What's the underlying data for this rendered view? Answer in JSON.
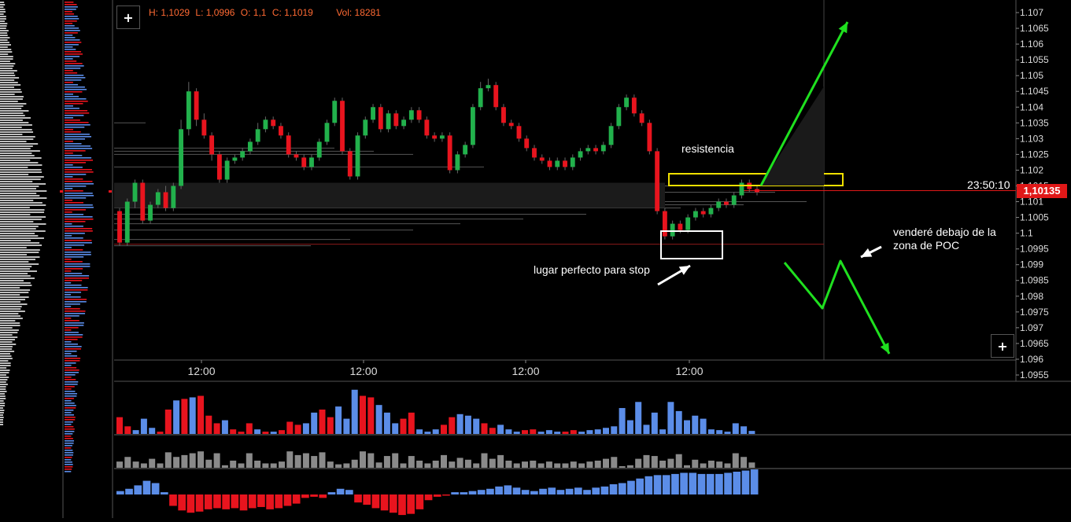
{
  "header": {
    "high": "H: 1,1029",
    "low": "L: 1,0996",
    "open": "O: 1,1",
    "close": "C: 1,1019",
    "volume": "Vol: 18281"
  },
  "buttons": {
    "add_top": "+",
    "add_bottom": "+"
  },
  "annotations": {
    "resistance": "resistencia",
    "stop": "lugar perfecto para stop",
    "sell_line1": "venderé debajo de la",
    "sell_line2": "zona de POC"
  },
  "timer": "23:50:10",
  "current_price": "1,10135",
  "colors": {
    "up": "#22b14c",
    "down": "#e8141e",
    "arrow": "#1fe01f",
    "zone": "#f0e000",
    "blue": "#5b8de8"
  },
  "chart_data": {
    "type": "candlestick",
    "x_ticks": [
      "12:00",
      "12:00",
      "12:00",
      "12:00"
    ],
    "y_ticks": [
      "1.107",
      "1.1065",
      "1.106",
      "1.1055",
      "1.105",
      "1.1045",
      "1.104",
      "1.1035",
      "1.103",
      "1.1025",
      "1.102",
      "1.1015",
      "1.101",
      "1.1005",
      "1.1",
      "1.0995",
      "1.099",
      "1.0985",
      "1.098",
      "1.0975",
      "1.097",
      "1.0965",
      "1.096",
      "1.0955"
    ],
    "ylim": [
      1.0955,
      1.107
    ],
    "candles": [
      [
        1.1007,
        1.0997,
        1.1008,
        1.0996
      ],
      [
        1.0997,
        1.101,
        1.1011,
        1.0996
      ],
      [
        1.101,
        1.1016,
        1.1017,
        1.1008
      ],
      [
        1.1016,
        1.1004,
        1.1017,
        1.1003
      ],
      [
        1.1004,
        1.1009,
        1.101,
        1.1003
      ],
      [
        1.1009,
        1.1013,
        1.1014,
        1.1008
      ],
      [
        1.1013,
        1.1008,
        1.1015,
        1.1007
      ],
      [
        1.1008,
        1.1015,
        1.1016,
        1.1007
      ],
      [
        1.1015,
        1.1033,
        1.1036,
        1.1014
      ],
      [
        1.1033,
        1.1045,
        1.1048,
        1.1031
      ],
      [
        1.1045,
        1.1036,
        1.1046,
        1.1034
      ],
      [
        1.1036,
        1.1031,
        1.1038,
        1.103
      ],
      [
        1.1031,
        1.1025,
        1.1032,
        1.1023
      ],
      [
        1.1025,
        1.1017,
        1.1026,
        1.1016
      ],
      [
        1.1017,
        1.1023,
        1.1024,
        1.1016
      ],
      [
        1.1023,
        1.1024,
        1.1025,
        1.1022
      ],
      [
        1.1024,
        1.1026,
        1.1027,
        1.1023
      ],
      [
        1.1026,
        1.1029,
        1.103,
        1.1025
      ],
      [
        1.1029,
        1.1033,
        1.1035,
        1.1028
      ],
      [
        1.1033,
        1.1036,
        1.1037,
        1.1032
      ],
      [
        1.1036,
        1.1034,
        1.1037,
        1.1033
      ],
      [
        1.1034,
        1.1031,
        1.1035,
        1.103
      ],
      [
        1.1031,
        1.1025,
        1.1032,
        1.1024
      ],
      [
        1.1025,
        1.1024,
        1.1026,
        1.1023
      ],
      [
        1.1024,
        1.1021,
        1.1025,
        1.102
      ],
      [
        1.1021,
        1.1024,
        1.1025,
        1.102
      ],
      [
        1.1024,
        1.1029,
        1.103,
        1.1023
      ],
      [
        1.1029,
        1.1035,
        1.1036,
        1.1028
      ],
      [
        1.1035,
        1.1042,
        1.1043,
        1.1034
      ],
      [
        1.1042,
        1.1026,
        1.1043,
        1.1025
      ],
      [
        1.1026,
        1.1018,
        1.1027,
        1.1017
      ],
      [
        1.1018,
        1.1031,
        1.1032,
        1.1017
      ],
      [
        1.1031,
        1.1036,
        1.1037,
        1.103
      ],
      [
        1.1036,
        1.104,
        1.1041,
        1.1035
      ],
      [
        1.104,
        1.1033,
        1.1041,
        1.1032
      ],
      [
        1.1033,
        1.1038,
        1.1039,
        1.1032
      ],
      [
        1.1038,
        1.1034,
        1.1039,
        1.1033
      ],
      [
        1.1034,
        1.1036,
        1.1037,
        1.1033
      ],
      [
        1.1036,
        1.1039,
        1.104,
        1.1035
      ],
      [
        1.1039,
        1.1036,
        1.104,
        1.1035
      ],
      [
        1.1036,
        1.1031,
        1.1037,
        1.103
      ],
      [
        1.1031,
        1.103,
        1.1032,
        1.1029
      ],
      [
        1.103,
        1.1031,
        1.1032,
        1.1029
      ],
      [
        1.1031,
        1.102,
        1.1032,
        1.1019
      ],
      [
        1.102,
        1.1025,
        1.1026,
        1.1019
      ],
      [
        1.1025,
        1.1028,
        1.1029,
        1.1024
      ],
      [
        1.1028,
        1.104,
        1.1041,
        1.1027
      ],
      [
        1.104,
        1.1046,
        1.1048,
        1.1039
      ],
      [
        1.1046,
        1.1047,
        1.1049,
        1.1045
      ],
      [
        1.1047,
        1.104,
        1.1048,
        1.1039
      ],
      [
        1.104,
        1.1035,
        1.1041,
        1.1034
      ],
      [
        1.1035,
        1.1034,
        1.1036,
        1.1033
      ],
      [
        1.1034,
        1.103,
        1.1035,
        1.1029
      ],
      [
        1.103,
        1.1027,
        1.1031,
        1.1026
      ],
      [
        1.1027,
        1.1024,
        1.1028,
        1.1023
      ],
      [
        1.1024,
        1.1023,
        1.1025,
        1.1022
      ],
      [
        1.1023,
        1.1021,
        1.1024,
        1.102
      ],
      [
        1.1021,
        1.1023,
        1.1024,
        1.102
      ],
      [
        1.1023,
        1.1021,
        1.1024,
        1.102
      ],
      [
        1.1021,
        1.1024,
        1.1025,
        1.102
      ],
      [
        1.1024,
        1.1026,
        1.1027,
        1.1023
      ],
      [
        1.1026,
        1.1027,
        1.1028,
        1.1025
      ],
      [
        1.1027,
        1.1026,
        1.1028,
        1.1025
      ],
      [
        1.1026,
        1.1028,
        1.1029,
        1.1025
      ],
      [
        1.1028,
        1.1034,
        1.1035,
        1.1027
      ],
      [
        1.1034,
        1.104,
        1.1041,
        1.1033
      ],
      [
        1.104,
        1.1043,
        1.1044,
        1.1039
      ],
      [
        1.1043,
        1.1038,
        1.1044,
        1.1037
      ],
      [
        1.1038,
        1.1035,
        1.1039,
        1.1034
      ],
      [
        1.1035,
        1.1026,
        1.1036,
        1.1025
      ],
      [
        1.1026,
        1.1007,
        1.1027,
        1.1006
      ],
      [
        1.1007,
        1.0999,
        1.1008,
        1.0998
      ],
      [
        1.0999,
        1.1003,
        1.1004,
        1.0998
      ],
      [
        1.1003,
        1.1001,
        1.1004,
        1.1
      ],
      [
        1.1001,
        1.1005,
        1.1006,
        1.1
      ],
      [
        1.1005,
        1.1007,
        1.1008,
        1.1004
      ],
      [
        1.1007,
        1.1006,
        1.1008,
        1.1005
      ],
      [
        1.1006,
        1.1008,
        1.1009,
        1.1005
      ],
      [
        1.1008,
        1.101,
        1.1011,
        1.1007
      ],
      [
        1.101,
        1.1009,
        1.1011,
        1.1008
      ],
      [
        1.1009,
        1.1012,
        1.1013,
        1.1008
      ],
      [
        1.1012,
        1.1016,
        1.1017,
        1.1011
      ],
      [
        1.1016,
        1.1014,
        1.1017,
        1.1013
      ],
      [
        1.1014,
        1.1013,
        1.1015,
        1.1012
      ]
    ],
    "volume": [
      22,
      10,
      5,
      20,
      8,
      3,
      32,
      44,
      46,
      48,
      50,
      24,
      14,
      18,
      6,
      3,
      14,
      6,
      3,
      3,
      5,
      16,
      12,
      14,
      28,
      32,
      22,
      36,
      20,
      58,
      50,
      48,
      38,
      28,
      14,
      20,
      28,
      6,
      3,
      6,
      12,
      22,
      26,
      24,
      20,
      14,
      8,
      12,
      6,
      3,
      5,
      6,
      3,
      5,
      3,
      3,
      5,
      3,
      5,
      6,
      8,
      10,
      34,
      18,
      42,
      12,
      28,
      6,
      42,
      30,
      18,
      24,
      20,
      6,
      5,
      3,
      14,
      10,
      4
    ],
    "delta": [
      3,
      5,
      8,
      12,
      10,
      2,
      -10,
      -14,
      -16,
      -15,
      -13,
      -12,
      -13,
      -12,
      -14,
      -12,
      -11,
      -13,
      -12,
      -10,
      -8,
      -3,
      -2,
      -3,
      2,
      5,
      4,
      -7,
      -9,
      -12,
      -14,
      -16,
      -18,
      -17,
      -13,
      -5,
      -2,
      -1,
      2,
      2,
      3,
      4,
      5,
      7,
      8,
      6,
      4,
      3,
      5,
      6,
      4,
      5,
      6,
      4,
      6,
      7,
      9,
      10,
      12,
      14,
      16,
      17,
      17,
      18,
      19,
      19,
      18,
      18,
      18,
      19,
      20,
      21,
      22
    ]
  }
}
